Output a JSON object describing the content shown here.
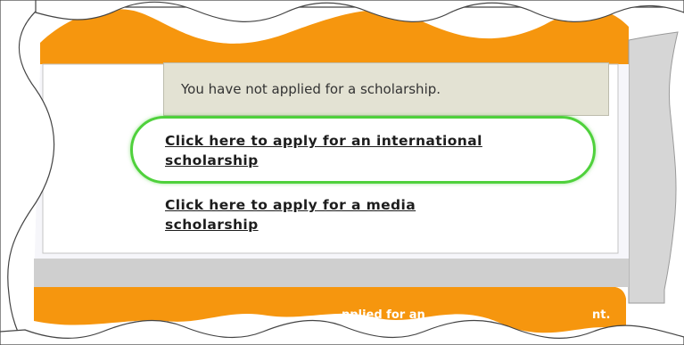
{
  "notice": {
    "text": "You have not applied for a scholarship."
  },
  "links": {
    "international_line1": "Click here to apply for an international",
    "international_line2": "scholarship",
    "media_line1": "Click here to apply for a media",
    "media_line2": "scholarship"
  },
  "banner": {
    "fragment_a": "pplied for an",
    "fragment_b": "nt."
  },
  "colors": {
    "orange": "#f6960e",
    "panel": "#f6f6fa",
    "shadow": "#cfcfcf",
    "highlight": "#4fd13c",
    "notice_bg": "#e3e2d3"
  }
}
